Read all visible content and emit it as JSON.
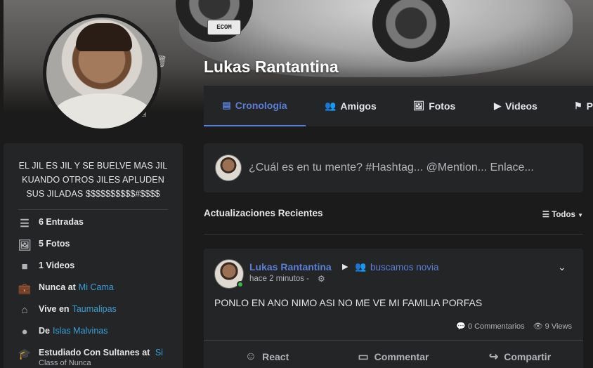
{
  "profile": {
    "name": "Lukas Rantantina",
    "cover_plate_text": "ECOM"
  },
  "tabs": [
    {
      "label": "Cronología",
      "icon": "timeline-icon",
      "glyph": "▤"
    },
    {
      "label": "Amigos",
      "icon": "users-icon",
      "glyph": "👥"
    },
    {
      "label": "Fotos",
      "icon": "photos-icon",
      "glyph": "🖼"
    },
    {
      "label": "Videos",
      "icon": "video-icon",
      "glyph": "▶"
    },
    {
      "label": "P",
      "icon": "flag-icon",
      "glyph": "⚑"
    }
  ],
  "sidebar": {
    "bio": "EL JIL ES JIL Y SE BUELVE MAS JIL KUANDO OTROS JILES APLUDEN SUS JILADAS $$$$$$$$$$#$$$$",
    "items": [
      {
        "icon": "posts-icon",
        "glyph": "☰",
        "text": "6 Entradas",
        "link": ""
      },
      {
        "icon": "photos-icon",
        "glyph": "🖼",
        "text": "5 Fotos",
        "link": ""
      },
      {
        "icon": "video-icon",
        "glyph": "■",
        "text": "1 Videos",
        "link": ""
      },
      {
        "icon": "briefcase-icon",
        "glyph": "💼",
        "text": "Nunca at",
        "link": "Mi Cama"
      },
      {
        "icon": "home-icon",
        "glyph": "⌂",
        "text": "Vive en",
        "link": "Taumalipas"
      },
      {
        "icon": "location-icon",
        "glyph": "●",
        "text": "De",
        "link": "Islas Malvinas"
      },
      {
        "icon": "graduation-icon",
        "glyph": "🎓",
        "text": "Estudiado Con Sultanes at",
        "link": "Si",
        "sub": "Class of Nunca"
      }
    ]
  },
  "composer": {
    "placeholder": "¿Cuál es en tu mente? #Hashtag... @Mention... Enlace..."
  },
  "feed": {
    "title": "Actualizaciones Recientes",
    "filter_label": "Todos"
  },
  "post": {
    "author": "Lukas Rantantina",
    "group": "buscamos novia",
    "time": "hace 2 minutos -",
    "body": "PONLO EN ANO NIMO ASI NO ME VE MI FAMILIA PORFAS",
    "comments": "0 Commentarios",
    "views": "9 Views",
    "actions": {
      "react": "React",
      "comment": "Commentar",
      "share": "Compartir"
    }
  },
  "colors": {
    "accent": "#5b7fd6",
    "link": "#3a9fd6",
    "online": "#3cb54a",
    "panel": "#242526",
    "background": "#1b1b1c"
  }
}
